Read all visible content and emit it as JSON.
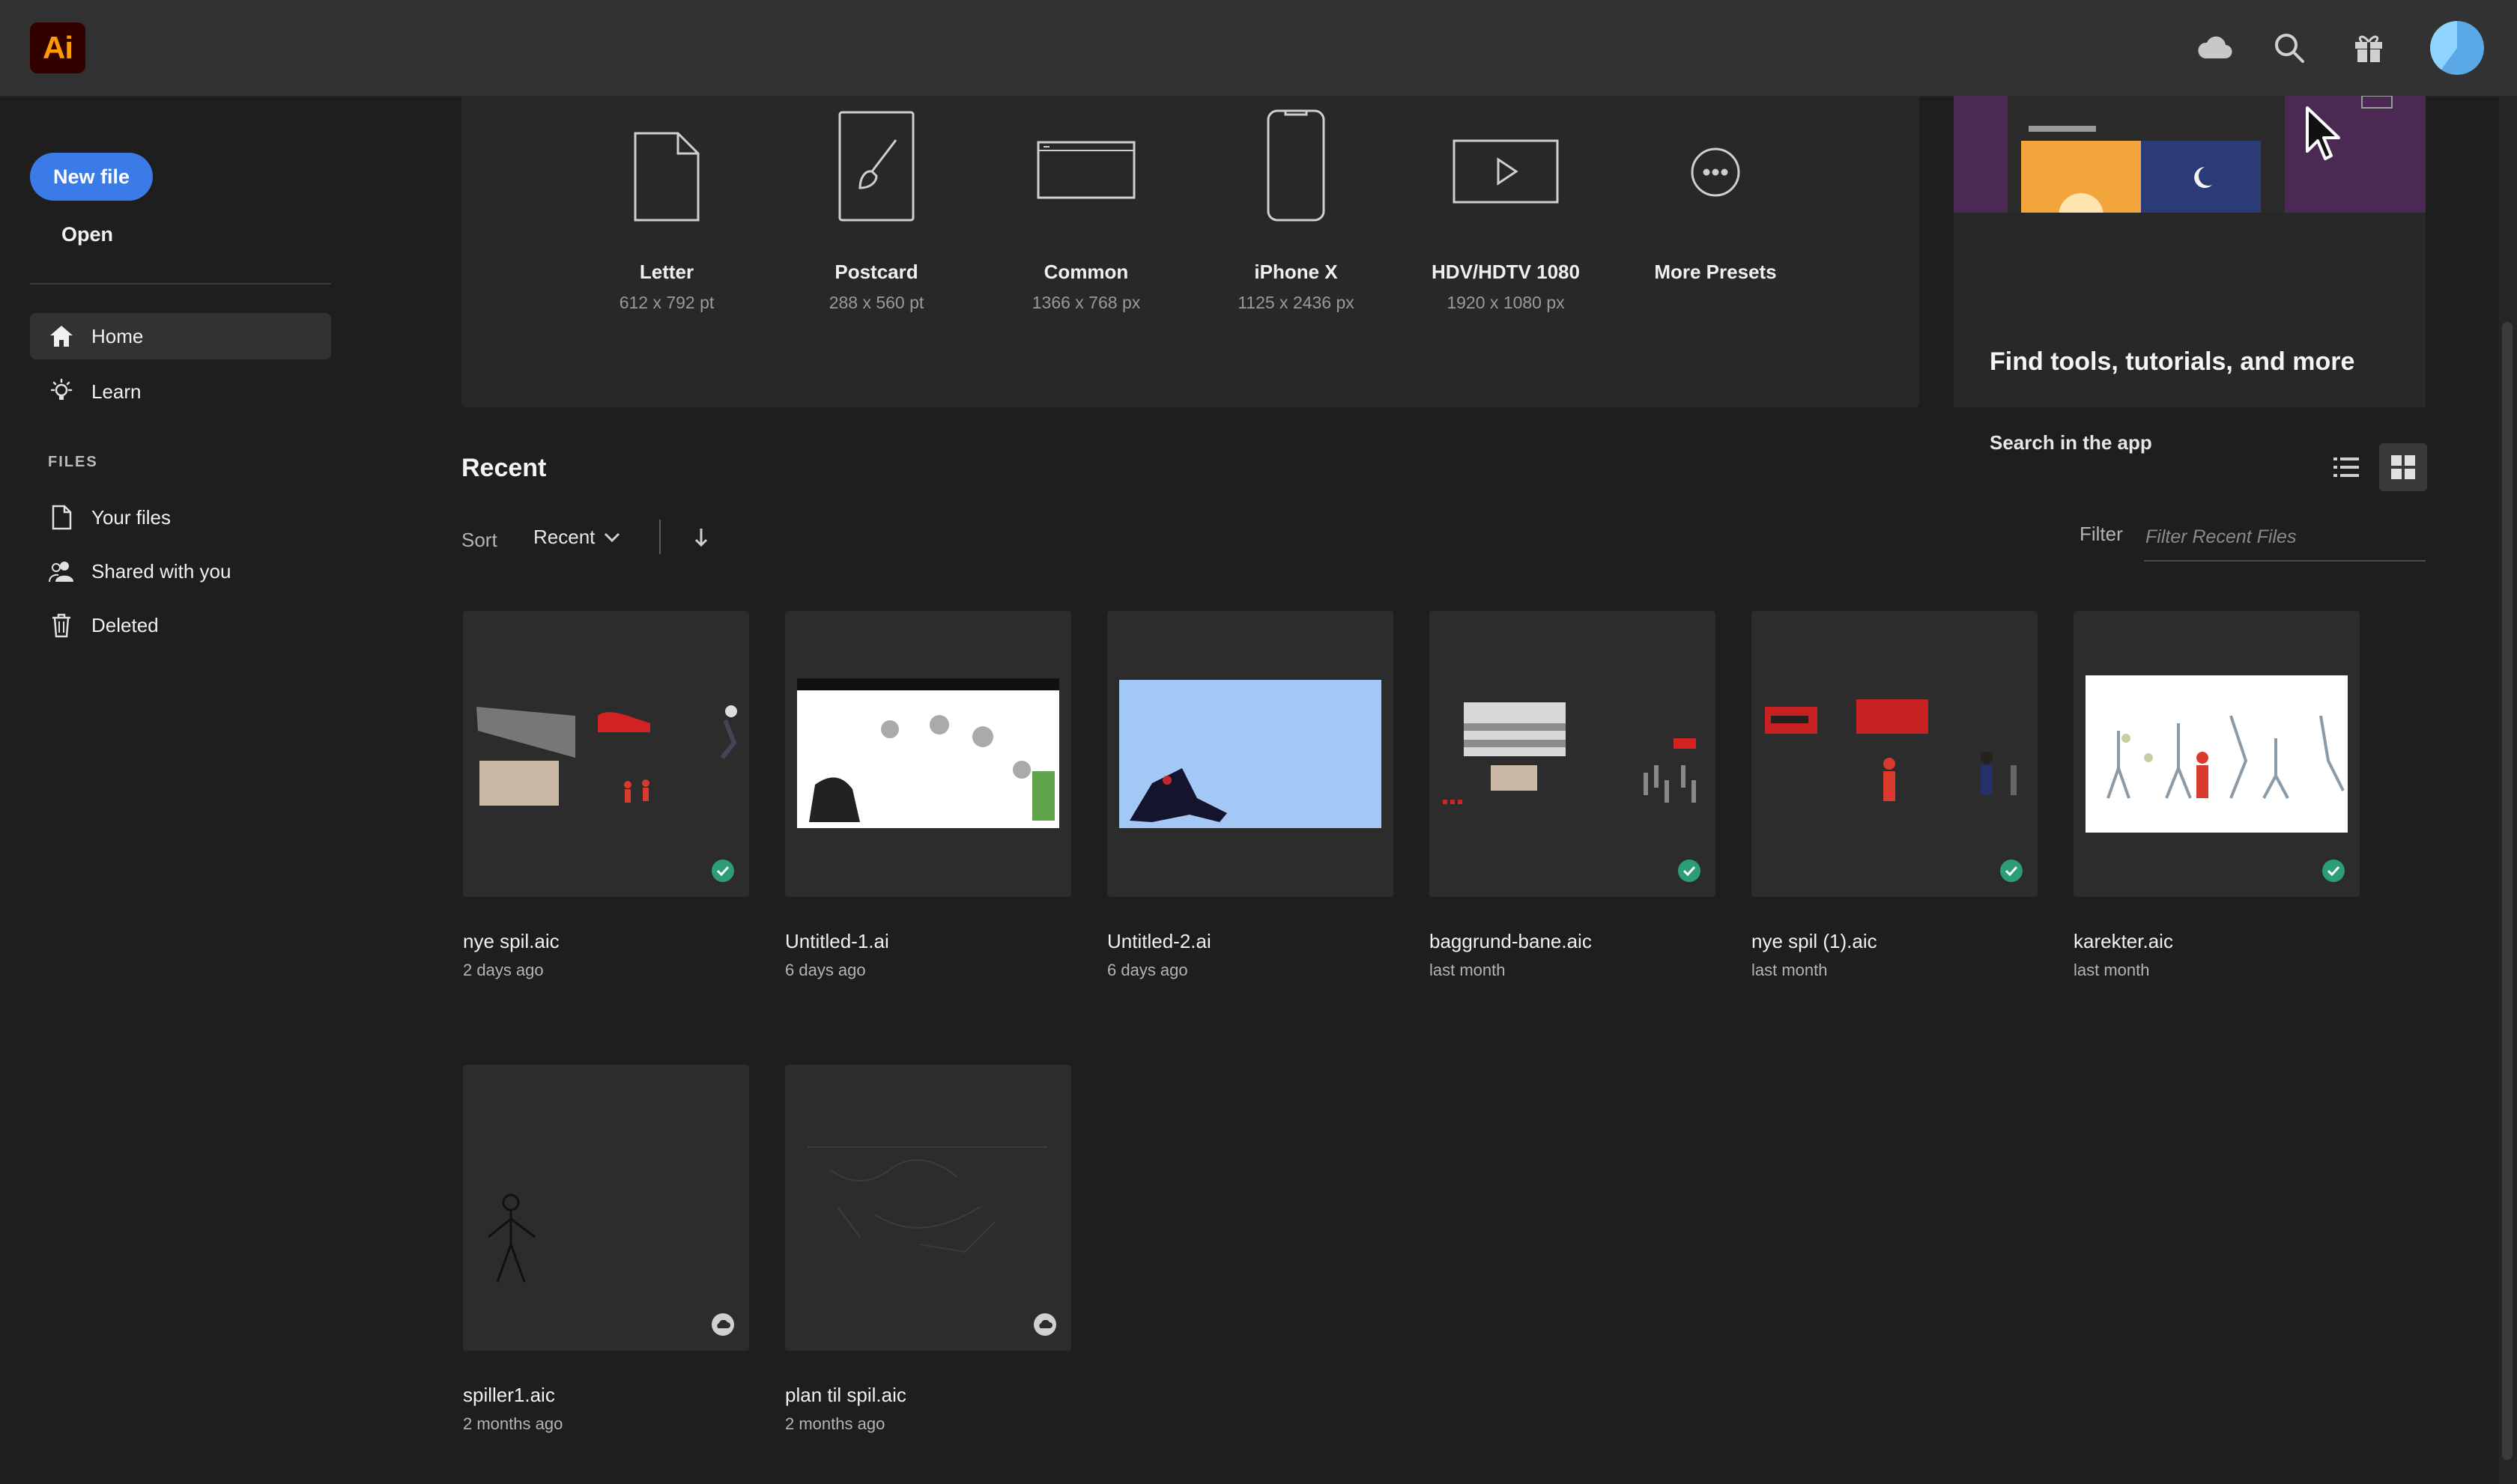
{
  "app": {
    "logo_text": "Ai",
    "brand_color": "#ff9a00",
    "brand_bg": "#330000",
    "accent": "#3b7be8"
  },
  "topbar": {
    "icons": [
      "cloud-icon",
      "search-icon",
      "gift-icon",
      "avatar"
    ]
  },
  "sidebar": {
    "new_file": "New file",
    "open": "Open",
    "nav": [
      {
        "label": "Home",
        "icon": "home-icon",
        "active": true
      },
      {
        "label": "Learn",
        "icon": "lightbulb-icon",
        "active": false
      }
    ],
    "files_heading": "FILES",
    "files": [
      {
        "label": "Your files",
        "icon": "document-icon"
      },
      {
        "label": "Shared with you",
        "icon": "shared-users-icon"
      },
      {
        "label": "Deleted",
        "icon": "trash-icon"
      }
    ]
  },
  "presets": [
    {
      "name": "Letter",
      "dim": "612 x 792 pt",
      "icon": "document-icon"
    },
    {
      "name": "Postcard",
      "dim": "288 x 560 pt",
      "icon": "brush-icon"
    },
    {
      "name": "Common",
      "dim": "1366 x 768 px",
      "icon": "browser-icon"
    },
    {
      "name": "iPhone X",
      "dim": "1125 x 2436 px",
      "icon": "phone-icon"
    },
    {
      "name": "HDV/HDTV 1080",
      "dim": "1920 x 1080 px",
      "icon": "video-icon"
    },
    {
      "name": "More Presets",
      "dim": "",
      "icon": "more-icon"
    }
  ],
  "help": {
    "title": "Find tools, tutorials, and more",
    "link": "Search in the app"
  },
  "recent": {
    "title": "Recent",
    "sort_label": "Sort",
    "sort_value": "Recent",
    "filter_label": "Filter",
    "filter_placeholder": "Filter Recent Files",
    "files": [
      {
        "name": "nye spil.aic",
        "date": "2 days ago",
        "status": "synced"
      },
      {
        "name": "Untitled-1.ai",
        "date": "6 days ago",
        "status": "none"
      },
      {
        "name": "Untitled-2.ai",
        "date": "6 days ago",
        "status": "none"
      },
      {
        "name": "baggrund-bane.aic",
        "date": "last month",
        "status": "synced"
      },
      {
        "name": "nye spil (1).aic",
        "date": "last month",
        "status": "synced"
      },
      {
        "name": "karekter.aic",
        "date": "last month",
        "status": "synced"
      },
      {
        "name": "spiller1.aic",
        "date": "2 months ago",
        "status": "cloud"
      },
      {
        "name": "plan til spil.aic",
        "date": "2 months ago",
        "status": "cloud"
      }
    ]
  }
}
